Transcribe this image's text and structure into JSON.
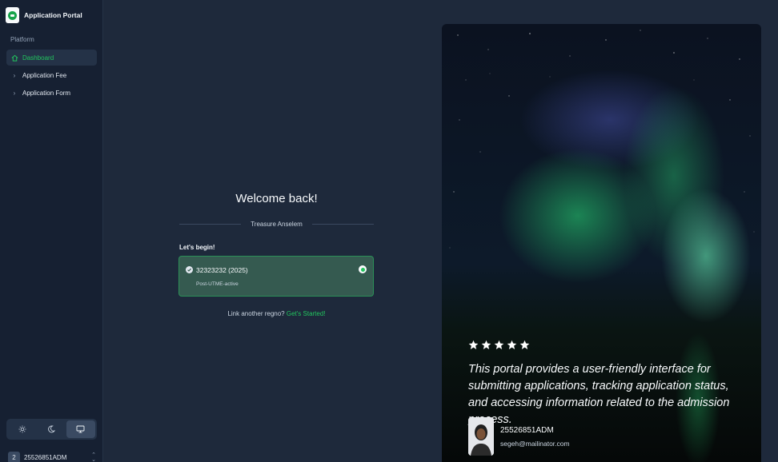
{
  "sidebar": {
    "brand_title": "Application Portal",
    "section_label": "Platform",
    "items": [
      {
        "label": "Dashboard",
        "icon": "home-icon"
      },
      {
        "label": "Application Fee",
        "icon": "chevron-right-icon"
      },
      {
        "label": "Application Form",
        "icon": "chevron-right-icon"
      }
    ],
    "theme_options": [
      "light",
      "dark",
      "system"
    ],
    "selected_theme": "system",
    "user": {
      "initial": "2",
      "id": "25526851ADM"
    }
  },
  "main": {
    "welcome": "Welcome back!",
    "user_name": "Treasure Anselem",
    "lets_begin": "Let's begin!",
    "reg_card": {
      "regno": "32323232 (2025)",
      "status": "Post-UTME-active"
    },
    "link_prompt": "Link another regno?",
    "link_action": "Get's Started!"
  },
  "hero": {
    "rating": 5,
    "quote": "This portal provides a user-friendly interface for submitting applications, tracking application status, and accessing information related to the admission process.",
    "author_name": "25526851ADM",
    "author_email": "segeh@mailinator.com"
  },
  "colors": {
    "accent": "#22c55e",
    "background": "#1e293b",
    "sidebar": "#162032"
  }
}
